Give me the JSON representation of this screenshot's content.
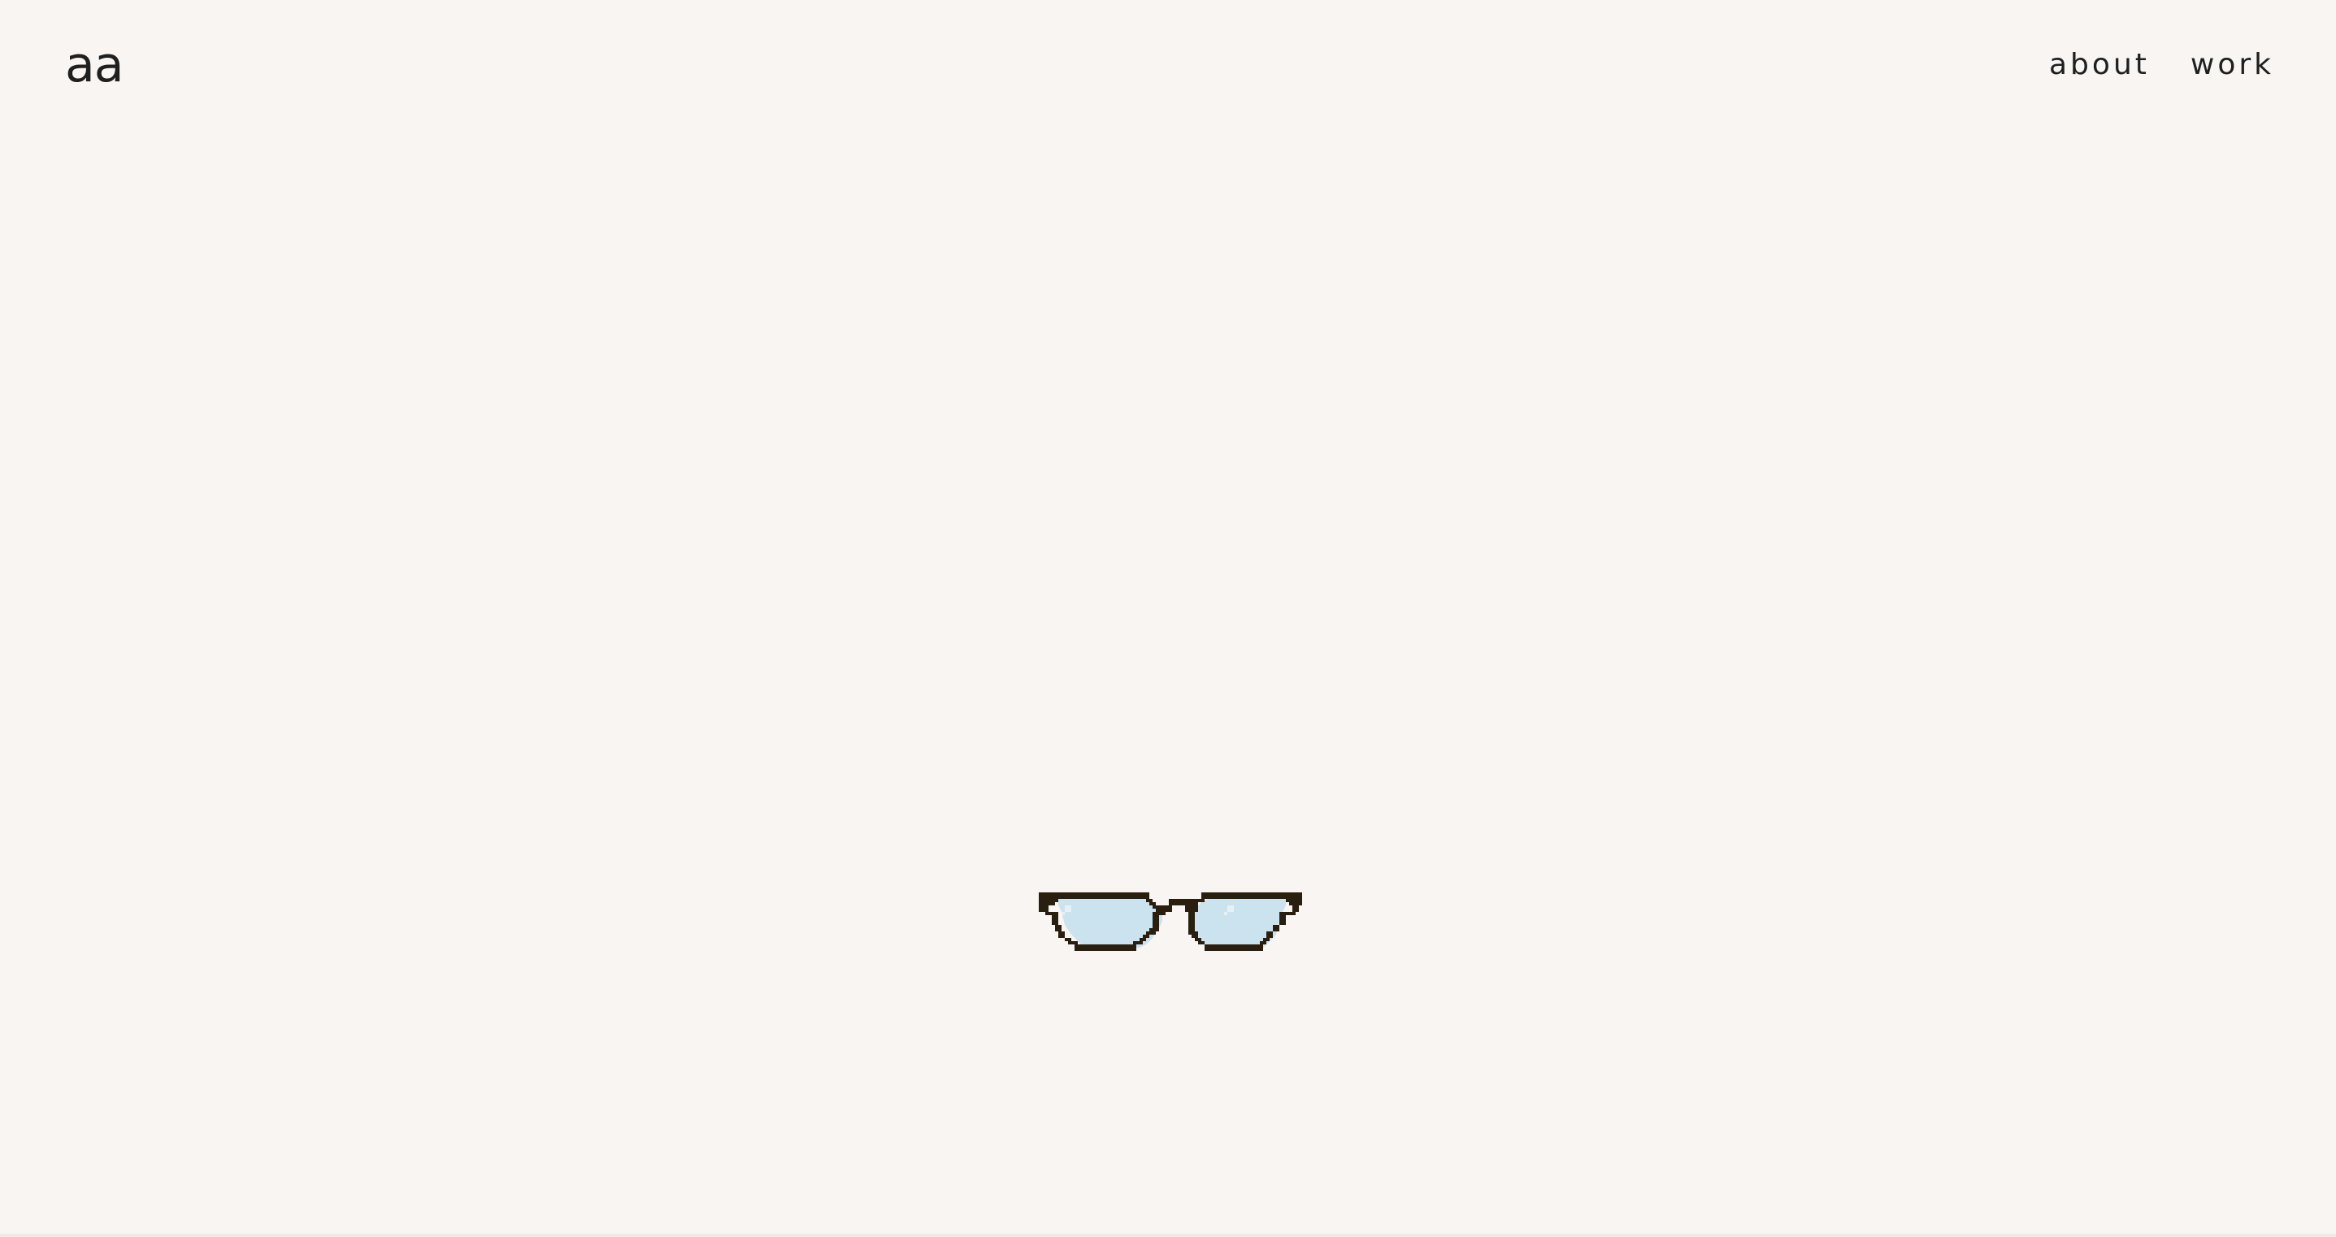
{
  "header": {
    "logo_text": "aa",
    "nav": [
      {
        "label": "about"
      },
      {
        "label": "work"
      }
    ]
  },
  "hero": {
    "image": "pixel-glasses-icon"
  },
  "colors": {
    "background": "#f8f5f2",
    "text": "#1f1f1f",
    "frame": "#2a1f0f",
    "lens": "#cbe3ef",
    "lens_highlight": "#e4f2f8"
  }
}
